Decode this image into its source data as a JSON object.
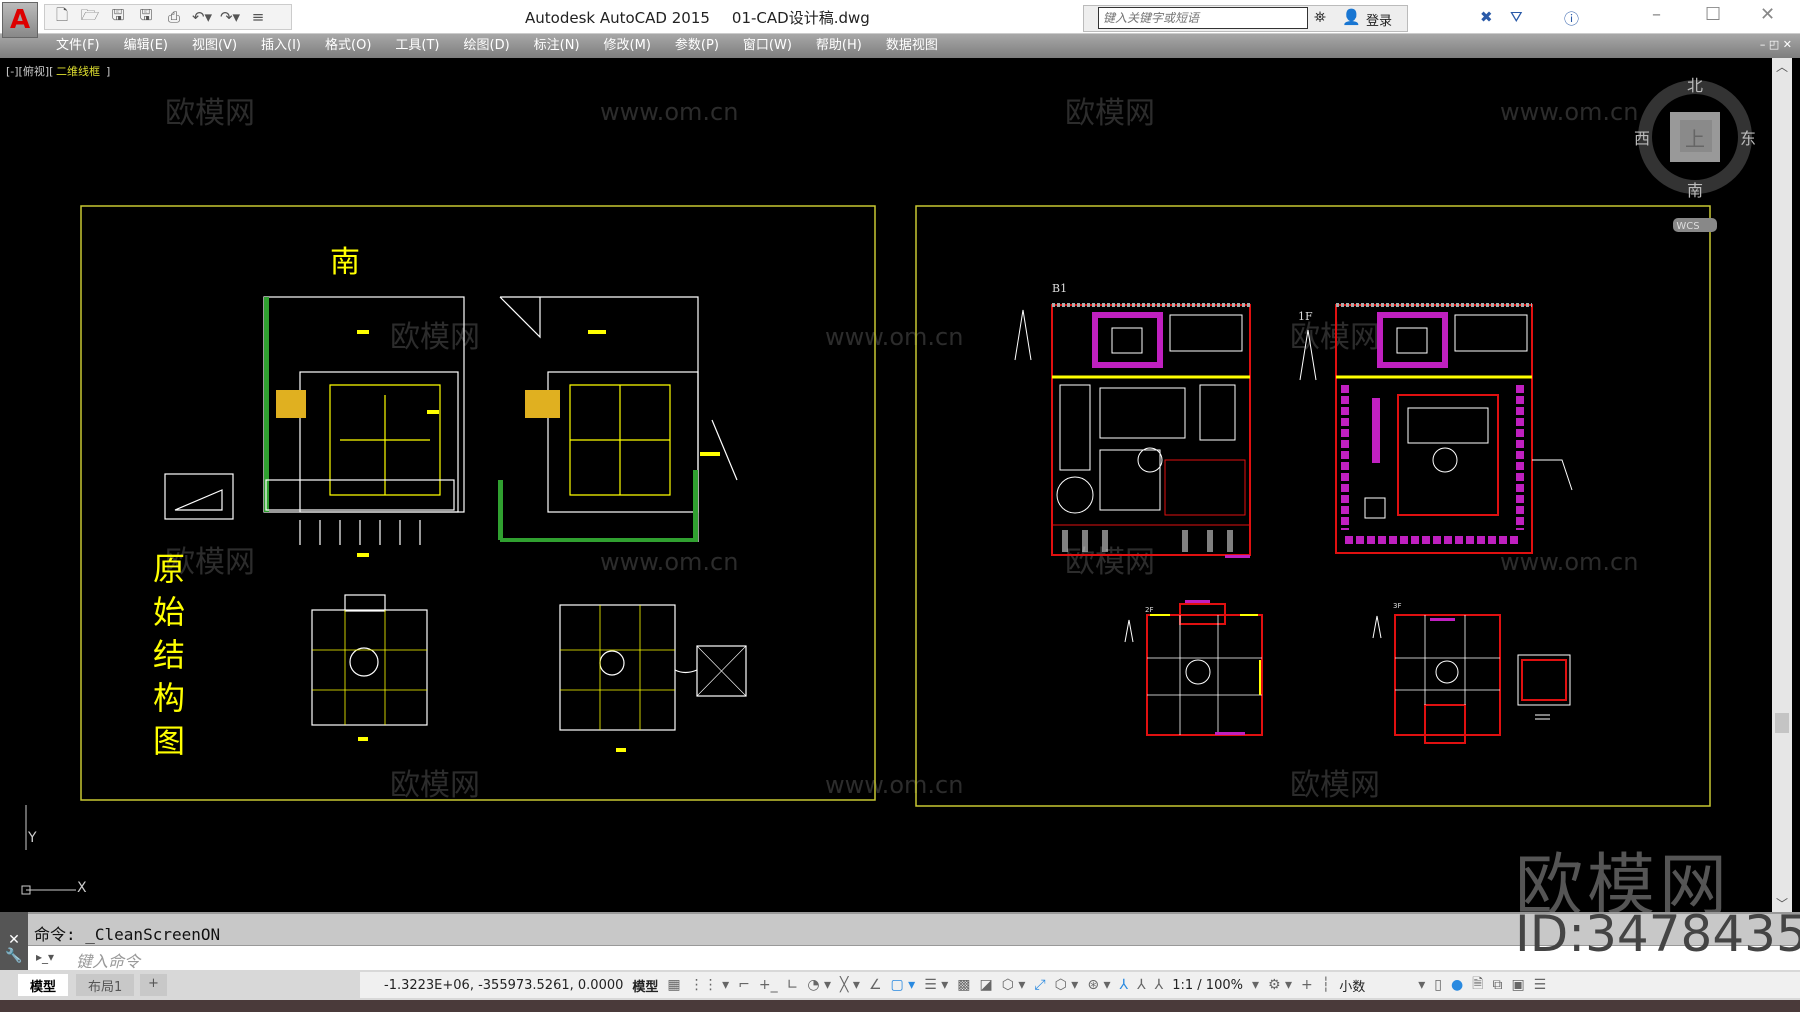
{
  "app": {
    "logo": "A",
    "title": "Autodesk AutoCAD 2015",
    "filename": "01-CAD设计稿.dwg"
  },
  "search": {
    "placeholder": "键入关键字或短语"
  },
  "user": {
    "login_label": "登录"
  },
  "menu": [
    "文件(F)",
    "编辑(E)",
    "视图(V)",
    "插入(I)",
    "格式(O)",
    "工具(T)",
    "绘图(D)",
    "标注(N)",
    "修改(M)",
    "参数(P)",
    "窗口(W)",
    "帮助(H)",
    "数据视图"
  ],
  "viewport": {
    "view_label": "[-][俯视][二维线框]",
    "view_prefix": "[-][俯视][",
    "view_style": "二维线框",
    "view_suffix": "]"
  },
  "viewcube": {
    "north": "北",
    "south": "南",
    "east": "东",
    "west": "西",
    "face": "上",
    "wcs": "WCS"
  },
  "drawing": {
    "left_title_south": "南",
    "left_vertical_title": [
      "原",
      "始",
      "结",
      "构",
      "图"
    ],
    "floor_labels": [
      "B1",
      "1F",
      "2F",
      "3F"
    ]
  },
  "ucs": {
    "x": "X",
    "y": "Y"
  },
  "watermarks": {
    "logo": "欧模网",
    "url": "www.om.cn",
    "id": "ID:3478435"
  },
  "command": {
    "history": "命令: _CleanScreenON",
    "placeholder": "键入命令"
  },
  "layout_tabs": [
    "模型",
    "布局1",
    "+"
  ],
  "status": {
    "coords": "-1.3223E+06, -355973.5261, 0.0000",
    "space": "模型",
    "scale": "1:1 / 100%",
    "units": "小数"
  },
  "colors": {
    "frame": "#c8c832",
    "wall": "#e01010",
    "furniture": "#ffffff",
    "accent": "#c020c0",
    "yellow": "#ffff00",
    "green": "#30a030"
  }
}
